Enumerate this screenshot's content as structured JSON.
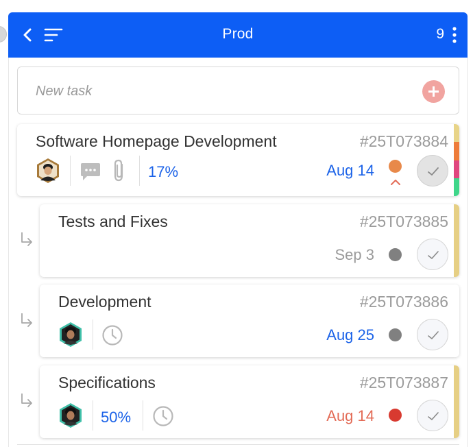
{
  "header": {
    "title": "Prod",
    "count": "9",
    "colors": {
      "bar": "#0d5ef5"
    }
  },
  "new_task": {
    "placeholder": "New task"
  },
  "tasks": [
    {
      "name": "Software Homepage Development",
      "code": "#25T073884",
      "progress": "17%",
      "date": "Aug 14",
      "date_color": "#1c63e8",
      "priority_color": "#e8894a",
      "priority_trend": "up",
      "stripe_colors": [
        "#e8d488",
        "#ee7c3a",
        "#e0467f",
        "#3fd68a"
      ],
      "has_comments": true,
      "has_attachments": true,
      "completed_style": "filled"
    },
    {
      "name": "Tests and Fixes",
      "code": "#25T073885",
      "date": "Sep 3",
      "date_color": "#9b9b9b",
      "priority_color": "#808080",
      "stripe_colors": [
        "#e6cf84"
      ],
      "subtask": true
    },
    {
      "name": "Development",
      "code": "#25T073886",
      "date": "Aug 25",
      "date_color": "#1c63e8",
      "priority_color": "#808080",
      "stripe_colors": [],
      "subtask": true,
      "has_timer": true
    },
    {
      "name": "Specifications",
      "code": "#25T073887",
      "progress": "50%",
      "date": "Aug 14",
      "date_color": "#e36b56",
      "priority_color": "#d83a30",
      "stripe_colors": [
        "#e6cf84"
      ],
      "subtask": true,
      "has_timer": true
    }
  ],
  "icons": {
    "back": "chevron-left-icon",
    "sort": "sort-lines-icon",
    "menu": "kebab-menu-icon",
    "add": "plus-icon",
    "comment": "comment-icon",
    "attachment": "paperclip-icon",
    "timer": "clock-icon",
    "complete": "checkmark-icon",
    "subtask": "subtask-arrow-icon"
  }
}
